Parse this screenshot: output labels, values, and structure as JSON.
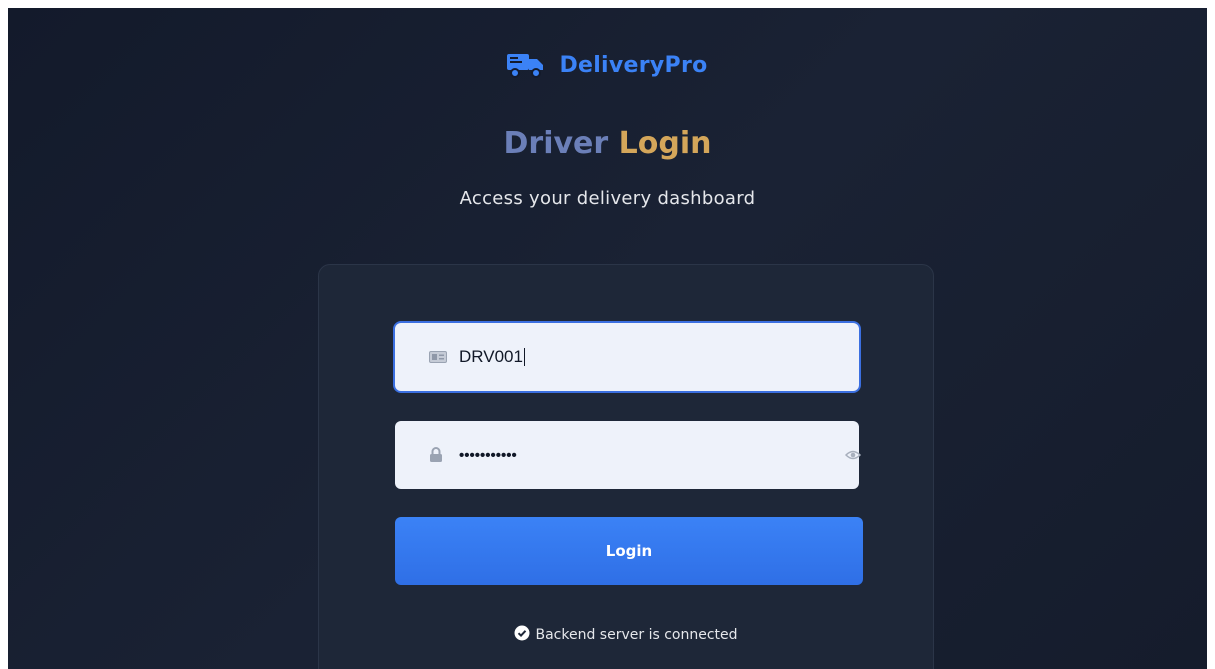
{
  "brand": {
    "name": "DeliveryPro",
    "icon": "truck-icon",
    "color": "#3b82f6"
  },
  "title": {
    "part1": "Driver",
    "part2": "Login"
  },
  "subtitle": "Access your delivery dashboard",
  "form": {
    "driver_id": {
      "icon": "id-card-icon",
      "value": "DRV001"
    },
    "password": {
      "icon": "lock-icon",
      "masked_value": "•••••••••••",
      "toggle_icon": "eye-icon"
    },
    "login_button": "Login"
  },
  "status": {
    "icon": "check-circle-icon",
    "text": "Backend server is connected"
  },
  "colors": {
    "accent": "#3b82f6",
    "title_gold": "#d4a65a",
    "title_blue": "#6b7fb8",
    "background": "#161d2d"
  }
}
